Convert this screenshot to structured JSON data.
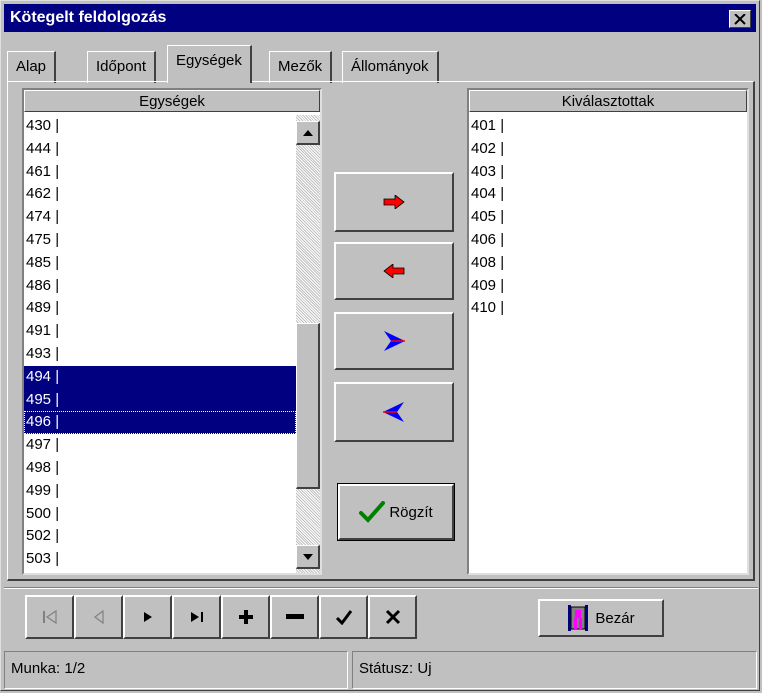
{
  "window": {
    "title": "Kötegelt feldolgozás"
  },
  "tabs": [
    {
      "label": "Alap"
    },
    {
      "label": "Időpont"
    },
    {
      "label": "Egységek"
    },
    {
      "label": "Mezők"
    },
    {
      "label": "Állományok"
    }
  ],
  "left_list": {
    "header": "Egységek",
    "items": [
      "430 |",
      "444 |",
      "461 |",
      "462 |",
      "474 |",
      "475 |",
      "485 |",
      "486 |",
      "489 |",
      "491 |",
      "493 |",
      "494 |",
      "495 |",
      "496 |",
      "497 |",
      "498 |",
      "499 |",
      "500 |",
      "502 |",
      "503 |"
    ],
    "selected": [
      "494 |",
      "495 |",
      "496 |"
    ],
    "focused": "496 |"
  },
  "right_list": {
    "header": "Kiválasztottak",
    "items": [
      "401 |",
      "402 |",
      "403 |",
      "404 |",
      "405 |",
      "406 |",
      "408 |",
      "409 |",
      "410 |"
    ]
  },
  "transfer_buttons": [
    {
      "icon": "arrow-right-red-icon"
    },
    {
      "icon": "arrow-left-red-icon"
    },
    {
      "icon": "arrow-right-all-blue-icon"
    },
    {
      "icon": "arrow-left-all-blue-icon"
    }
  ],
  "save_button": {
    "label": "Rögzít",
    "icon": "checkmark-icon"
  },
  "navigator": [
    {
      "icon": "first-record-icon",
      "enabled": false
    },
    {
      "icon": "prior-record-icon",
      "enabled": false
    },
    {
      "icon": "next-record-icon",
      "enabled": true
    },
    {
      "icon": "last-record-icon",
      "enabled": true
    },
    {
      "icon": "insert-icon",
      "enabled": true
    },
    {
      "icon": "delete-icon",
      "enabled": true
    },
    {
      "icon": "post-icon",
      "enabled": true
    },
    {
      "icon": "cancel-icon",
      "enabled": true
    }
  ],
  "close_button": {
    "label": "Bezár",
    "icon": "door-exit-icon"
  },
  "statusbar": {
    "left": "Munka: 1/2",
    "right": "Státusz: Uj"
  },
  "colors": {
    "titlebar": "#000080",
    "selection": "#000080",
    "face": "#c0c0c0",
    "arrow_red": "#ff0000",
    "arrow_blue": "#0000ff",
    "check_green": "#008000"
  }
}
